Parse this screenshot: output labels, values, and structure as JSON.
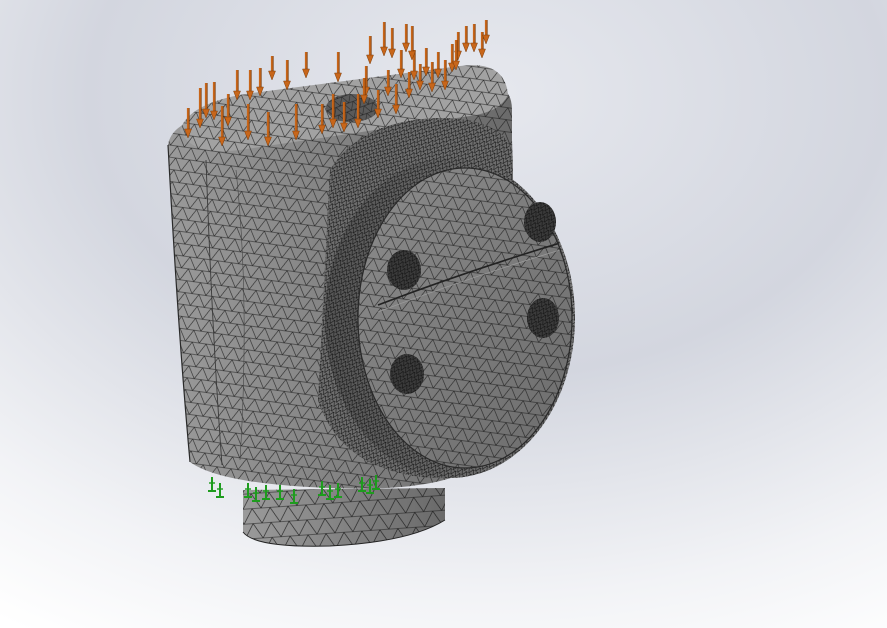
{
  "viewport": {
    "background_top": "#c9cdd8",
    "background_bottom": "#ffffff"
  },
  "model": {
    "mesh_fill": "#7a7a7a",
    "mesh_line": "#161616",
    "mesh_highlight": "#b8b8b8",
    "load_arrow_color": "#c8661a",
    "load_arrow_dark": "#7a3a08",
    "fixture_color": "#1e9c1e"
  }
}
